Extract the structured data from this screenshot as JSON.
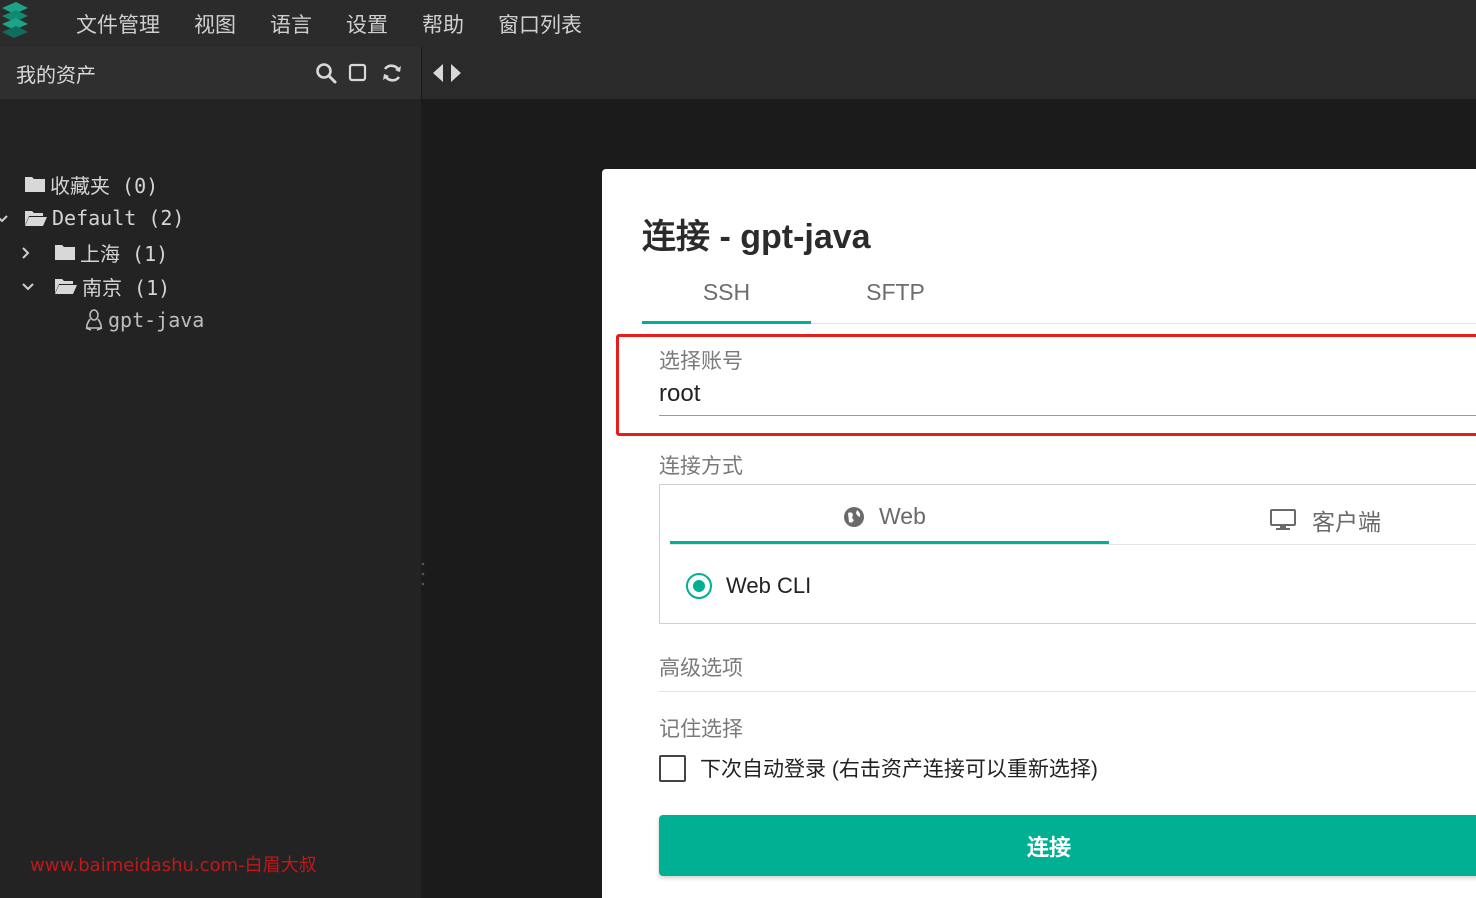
{
  "menubar": {
    "items": [
      "文件管理",
      "视图",
      "语言",
      "设置",
      "帮助",
      "窗口列表"
    ]
  },
  "sidebar": {
    "title": "我的资产",
    "tools": [
      "search-icon",
      "square-icon",
      "refresh-icon"
    ],
    "tree": [
      {
        "label": "收藏夹 (0)",
        "icon": "folder-icon"
      },
      {
        "label": "Default (2)",
        "icon": "folder-open-icon",
        "expanded": true
      },
      {
        "label": "上海 (1)",
        "icon": "folder-icon",
        "expanded": false
      },
      {
        "label": "南京 (1)",
        "icon": "folder-open-icon",
        "expanded": true
      },
      {
        "label": "gpt-java",
        "icon": "linux-penguin-icon"
      }
    ]
  },
  "watermark": "www.baimeidashu.com-白眉大叔",
  "dialog": {
    "title": "连接 - gpt-java",
    "tabs": [
      "SSH",
      "SFTP"
    ],
    "active_tab": "SSH",
    "account_label": "选择账号",
    "account_value": "root",
    "method_label": "连接方式",
    "method_tabs": [
      {
        "label": "Web",
        "icon": "globe-icon"
      },
      {
        "label": "客户端",
        "icon": "monitor-icon"
      }
    ],
    "active_method": "Web",
    "radio_option": "Web CLI",
    "advanced_label": "高级选项",
    "remember_label": "记住选择",
    "checkbox_label": "下次自动登录 (右击资产连接可以重新选择)",
    "connect_button": "连接"
  },
  "colors": {
    "accent": "#00b093",
    "highlight_box": "#e41e1e",
    "watermark": "#c0181b"
  }
}
